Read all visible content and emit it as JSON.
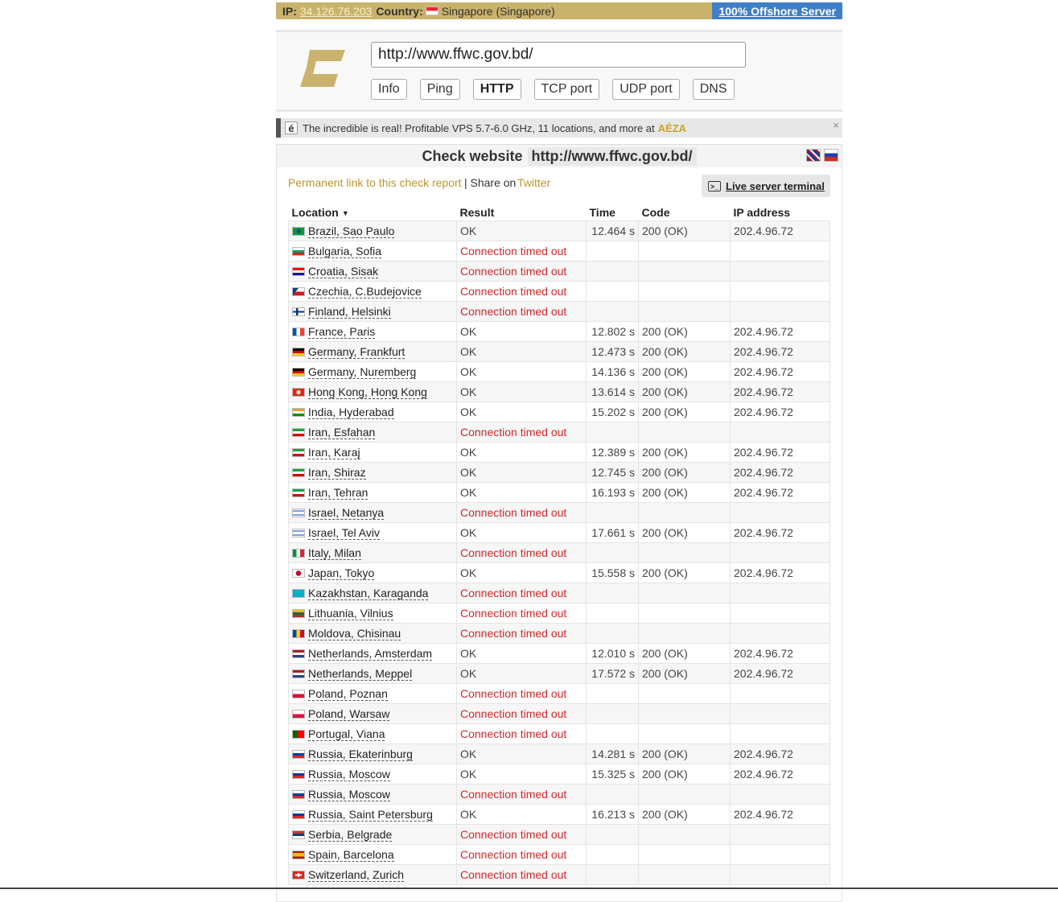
{
  "ipbar": {
    "ip_label": "IP:",
    "ip": "34.126.76.203",
    "country_label": "Country:",
    "country": "Singapore (Singapore)",
    "offshore": "100% Offshore Server"
  },
  "header": {
    "url": "http://www.ffwc.gov.bd/",
    "buttons": [
      "Info",
      "Ping",
      "HTTP",
      "TCP port",
      "UDP port",
      "DNS"
    ],
    "active": "HTTP"
  },
  "ad": {
    "icon": "é",
    "text": "The incredible is real! Profitable VPS 5.7-6.0 GHz, 11 locations, and more at",
    "brand": "AÉZA",
    "close": "×"
  },
  "check": {
    "title": "Check website",
    "url": "http://www.ffwc.gov.bd/",
    "permanent_link": "Permanent link to this check report",
    "share_text": "| Share on",
    "twitter": "Twitter",
    "terminal": "Live server terminal",
    "terminal_icon": ">_"
  },
  "table": {
    "headers": {
      "location": "Location",
      "result": "Result",
      "time": "Time",
      "code": "Code",
      "ip": "IP address"
    },
    "sort_arrow": "▼",
    "rows": [
      {
        "loc": "Brazil, Sao Paulo",
        "flag": "br",
        "result": "OK",
        "time": "12.464 s",
        "code": "200 (OK)",
        "ip": "202.4.96.72"
      },
      {
        "loc": "Bulgaria, Sofia",
        "flag": "bg",
        "result": "Connection timed out",
        "time": "",
        "code": "",
        "ip": ""
      },
      {
        "loc": "Croatia, Sisak",
        "flag": "hr",
        "result": "Connection timed out",
        "time": "",
        "code": "",
        "ip": ""
      },
      {
        "loc": "Czechia, C.Budejovice",
        "flag": "cz",
        "result": "Connection timed out",
        "time": "",
        "code": "",
        "ip": ""
      },
      {
        "loc": "Finland, Helsinki",
        "flag": "fi",
        "result": "Connection timed out",
        "time": "",
        "code": "",
        "ip": ""
      },
      {
        "loc": "France, Paris",
        "flag": "fr",
        "result": "OK",
        "time": "12.802 s",
        "code": "200 (OK)",
        "ip": "202.4.96.72"
      },
      {
        "loc": "Germany, Frankfurt",
        "flag": "de",
        "result": "OK",
        "time": "12.473 s",
        "code": "200 (OK)",
        "ip": "202.4.96.72"
      },
      {
        "loc": "Germany, Nuremberg",
        "flag": "de",
        "result": "OK",
        "time": "14.136 s",
        "code": "200 (OK)",
        "ip": "202.4.96.72"
      },
      {
        "loc": "Hong Kong, Hong Kong",
        "flag": "hk",
        "result": "OK",
        "time": "13.614 s",
        "code": "200 (OK)",
        "ip": "202.4.96.72"
      },
      {
        "loc": "India, Hyderabad",
        "flag": "in",
        "result": "OK",
        "time": "15.202 s",
        "code": "200 (OK)",
        "ip": "202.4.96.72"
      },
      {
        "loc": "Iran, Esfahan",
        "flag": "ir",
        "result": "Connection timed out",
        "time": "",
        "code": "",
        "ip": ""
      },
      {
        "loc": "Iran, Karaj",
        "flag": "ir",
        "result": "OK",
        "time": "12.389 s",
        "code": "200 (OK)",
        "ip": "202.4.96.72"
      },
      {
        "loc": "Iran, Shiraz",
        "flag": "ir",
        "result": "OK",
        "time": "12.745 s",
        "code": "200 (OK)",
        "ip": "202.4.96.72"
      },
      {
        "loc": "Iran, Tehran",
        "flag": "ir",
        "result": "OK",
        "time": "16.193 s",
        "code": "200 (OK)",
        "ip": "202.4.96.72"
      },
      {
        "loc": "Israel, Netanya",
        "flag": "il",
        "result": "Connection timed out",
        "time": "",
        "code": "",
        "ip": ""
      },
      {
        "loc": "Israel, Tel Aviv",
        "flag": "il",
        "result": "OK",
        "time": "17.661 s",
        "code": "200 (OK)",
        "ip": "202.4.96.72"
      },
      {
        "loc": "Italy, Milan",
        "flag": "it",
        "result": "Connection timed out",
        "time": "",
        "code": "",
        "ip": ""
      },
      {
        "loc": "Japan, Tokyo",
        "flag": "jp",
        "result": "OK",
        "time": "15.558 s",
        "code": "200 (OK)",
        "ip": "202.4.96.72"
      },
      {
        "loc": "Kazakhstan, Karaganda",
        "flag": "kz",
        "result": "Connection timed out",
        "time": "",
        "code": "",
        "ip": ""
      },
      {
        "loc": "Lithuania, Vilnius",
        "flag": "lt",
        "result": "Connection timed out",
        "time": "",
        "code": "",
        "ip": ""
      },
      {
        "loc": "Moldova, Chisinau",
        "flag": "md",
        "result": "Connection timed out",
        "time": "",
        "code": "",
        "ip": ""
      },
      {
        "loc": "Netherlands, Amsterdam",
        "flag": "nl",
        "result": "OK",
        "time": "12.010 s",
        "code": "200 (OK)",
        "ip": "202.4.96.72"
      },
      {
        "loc": "Netherlands, Meppel",
        "flag": "nl",
        "result": "OK",
        "time": "17.572 s",
        "code": "200 (OK)",
        "ip": "202.4.96.72"
      },
      {
        "loc": "Poland, Poznan",
        "flag": "pl",
        "result": "Connection timed out",
        "time": "",
        "code": "",
        "ip": ""
      },
      {
        "loc": "Poland, Warsaw",
        "flag": "pl",
        "result": "Connection timed out",
        "time": "",
        "code": "",
        "ip": ""
      },
      {
        "loc": "Portugal, Viana",
        "flag": "pt",
        "result": "Connection timed out",
        "time": "",
        "code": "",
        "ip": ""
      },
      {
        "loc": "Russia, Ekaterinburg",
        "flag": "ru",
        "result": "OK",
        "time": "14.281 s",
        "code": "200 (OK)",
        "ip": "202.4.96.72"
      },
      {
        "loc": "Russia, Moscow",
        "flag": "ru",
        "result": "OK",
        "time": "15.325 s",
        "code": "200 (OK)",
        "ip": "202.4.96.72"
      },
      {
        "loc": "Russia, Moscow",
        "flag": "ru",
        "result": "Connection timed out",
        "time": "",
        "code": "",
        "ip": ""
      },
      {
        "loc": "Russia, Saint Petersburg",
        "flag": "ru",
        "result": "OK",
        "time": "16.213 s",
        "code": "200 (OK)",
        "ip": "202.4.96.72"
      },
      {
        "loc": "Serbia, Belgrade",
        "flag": "rs",
        "result": "Connection timed out",
        "time": "",
        "code": "",
        "ip": ""
      },
      {
        "loc": "Spain, Barcelona",
        "flag": "es",
        "result": "Connection timed out",
        "time": "",
        "code": "",
        "ip": ""
      },
      {
        "loc": "Switzerland, Zurich",
        "flag": "ch",
        "result": "Connection timed out",
        "time": "",
        "code": "",
        "ip": ""
      }
    ]
  },
  "colors": {
    "gold": "#c9b26b",
    "link": "#b8962e",
    "offshore_blue": "#3f7fc7",
    "error_red": "#d0282c"
  },
  "icons": {
    "logo": "c-logo-icon",
    "terminal": "terminal-icon",
    "close": "close-icon"
  }
}
